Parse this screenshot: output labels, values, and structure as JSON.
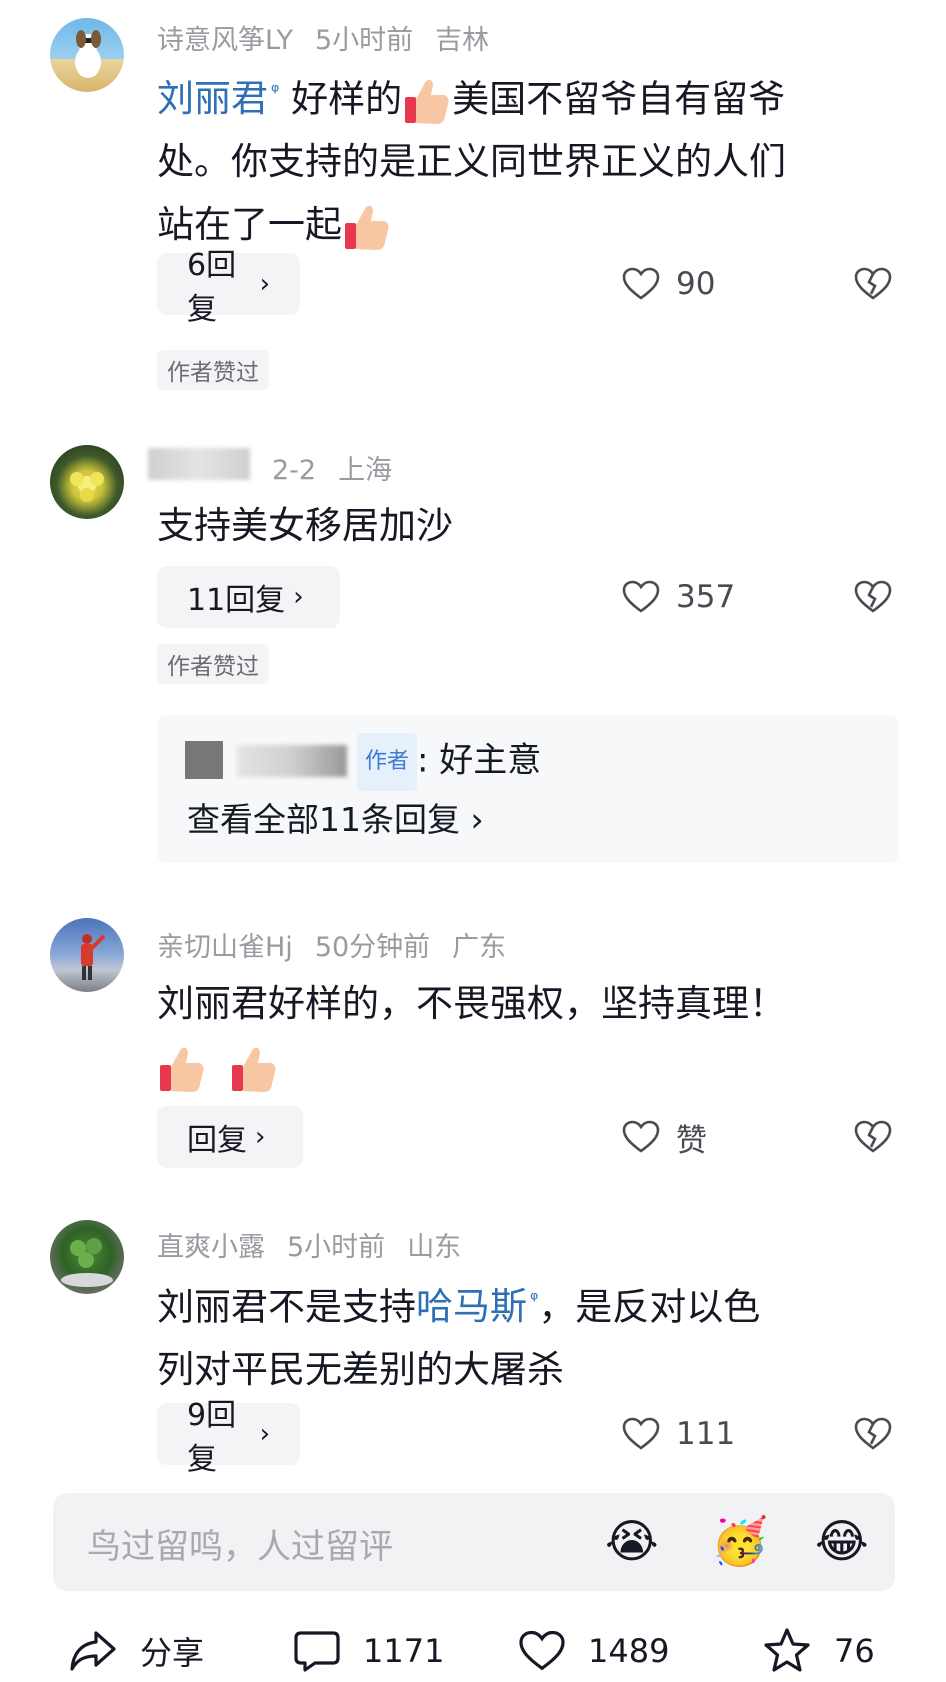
{
  "comments": [
    {
      "user": "诗意风筝LY",
      "time": "5小时前",
      "location": "吉林",
      "keyword": "刘丽君",
      "text_1": "好样的",
      "text_2": "美国不留爷自有留爷",
      "line_2": "处。你支持的是正义同世界正义的人们",
      "line_3": "站在了一起",
      "reply_btn": "6回复",
      "likes": "90",
      "tag": "作者赞过"
    },
    {
      "user_tail": "2-2",
      "location": "上海",
      "text": "支持美女移居加沙",
      "reply_btn": "11回复",
      "likes": "357",
      "tag": "作者赞过",
      "sub_reply": {
        "author_tag": "作者",
        "text": ": 好主意",
        "view_all": "查看全部11条回复"
      }
    },
    {
      "user": "亲切山雀Hj",
      "time": "50分钟前",
      "location": "广东",
      "text": "刘丽君好样的，不畏强权，坚持真理！",
      "reply_btn": "回复",
      "likes": "赞"
    },
    {
      "user": "直爽小露",
      "time": "5小时前",
      "location": "山东",
      "text_1": "刘丽君不是支持",
      "keyword": "哈马斯",
      "text_2": "，是反对以色",
      "line_2": "列对平民无差别的大屠杀",
      "reply_btn": "9回复",
      "likes": "111"
    }
  ],
  "input": {
    "placeholder": "鸟过留鸣，人过留评",
    "emojis": [
      "😭",
      "🥳",
      "😂"
    ]
  },
  "bottom_bar": {
    "share": "分享",
    "comments": "1171",
    "likes": "1489",
    "favorites": "76"
  },
  "colors": {
    "keyword": "#2f6fb5",
    "meta": "#9a9ba0",
    "chip_bg": "#f4f4f6"
  },
  "chevron": "›"
}
